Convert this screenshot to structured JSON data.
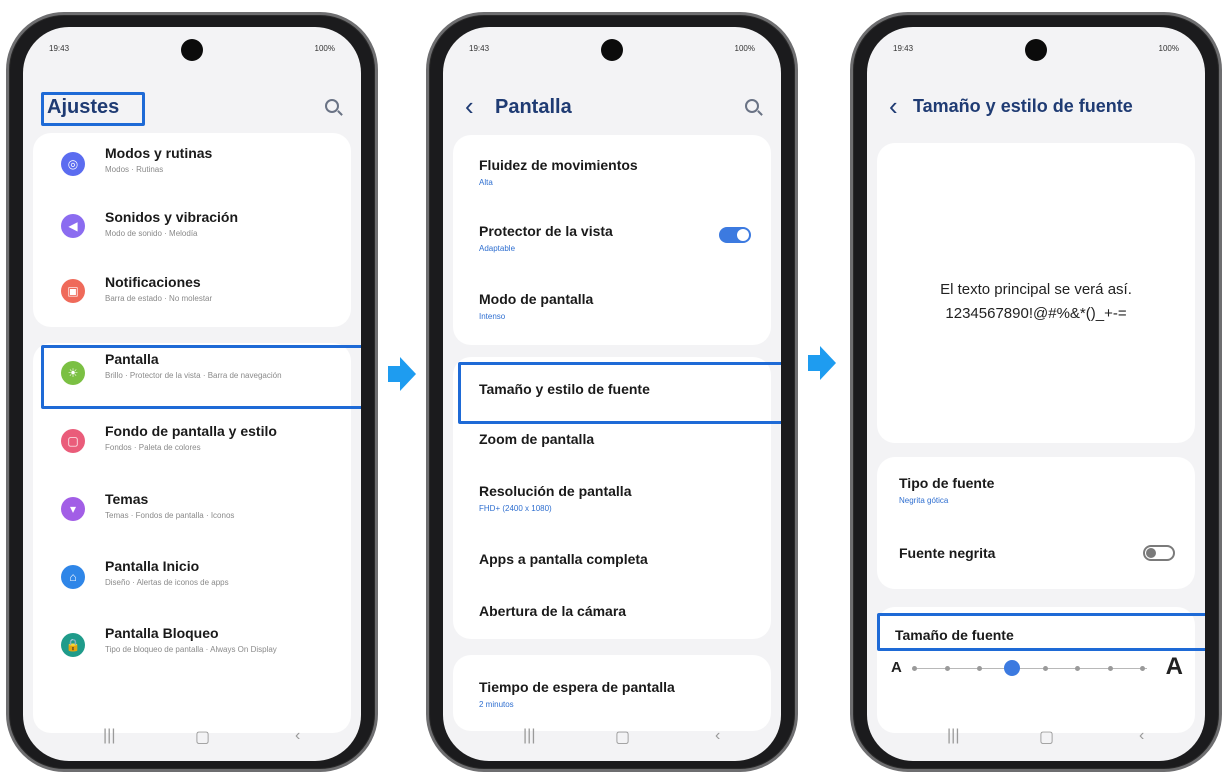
{
  "status": {
    "time": "19:43",
    "right": "100%"
  },
  "phone1": {
    "title": "Ajustes",
    "items": [
      {
        "title": "Modos y rutinas",
        "sub": "Modos · Rutinas",
        "color": "#5b6cf0"
      },
      {
        "title": "Sonidos y vibración",
        "sub": "Modo de sonido · Melodía",
        "color": "#8b6cf0"
      },
      {
        "title": "Notificaciones",
        "sub": "Barra de estado · No molestar",
        "color": "#ef6a5a"
      },
      {
        "title": "Pantalla",
        "sub": "Brillo · Protector de la vista · Barra de navegación",
        "color": "#7bc043"
      },
      {
        "title": "Fondo de pantalla y estilo",
        "sub": "Fondos · Paleta de colores",
        "color": "#ea5c7a"
      },
      {
        "title": "Temas",
        "sub": "Temas · Fondos de pantalla · Iconos",
        "color": "#a25ee6"
      },
      {
        "title": "Pantalla Inicio",
        "sub": "Diseño · Alertas de iconos de apps",
        "color": "#2f86e8"
      },
      {
        "title": "Pantalla Bloqueo",
        "sub": "Tipo de bloqueo de pantalla · Always On Display",
        "color": "#1f9b8a"
      }
    ]
  },
  "phone2": {
    "title": "Pantalla",
    "items": [
      {
        "title": "Fluidez de movimientos",
        "sub": "Alta"
      },
      {
        "title": "Protector de la vista",
        "sub": "Adaptable"
      },
      {
        "title": "Modo de pantalla",
        "sub": "Intenso"
      },
      {
        "title": "Tamaño y estilo de fuente",
        "sub": ""
      },
      {
        "title": "Zoom de pantalla",
        "sub": ""
      },
      {
        "title": "Resolución de pantalla",
        "sub": "FHD+ (2400 x 1080)"
      },
      {
        "title": "Apps a pantalla completa",
        "sub": ""
      },
      {
        "title": "Abertura de la cámara",
        "sub": ""
      },
      {
        "title": "Tiempo de espera de pantalla",
        "sub": "2 minutos"
      }
    ],
    "eye_protector_on": true
  },
  "phone3": {
    "title": "Tamaño y estilo de fuente",
    "preview_line1": "El texto principal se verá así.",
    "preview_line2": "1234567890!@#%&*()_+-=",
    "font_type_label": "Tipo de fuente",
    "font_type_value": "Negrita gótica",
    "bold_label": "Fuente negrita",
    "bold_on": false,
    "size_label": "Tamaño de fuente",
    "small_a": "A",
    "big_a": "A",
    "size_steps": 8,
    "size_level": 3
  },
  "colors": {
    "accent": "#1e6ad6",
    "arrow": "#1e9cf0",
    "title": "#1f3b73"
  }
}
